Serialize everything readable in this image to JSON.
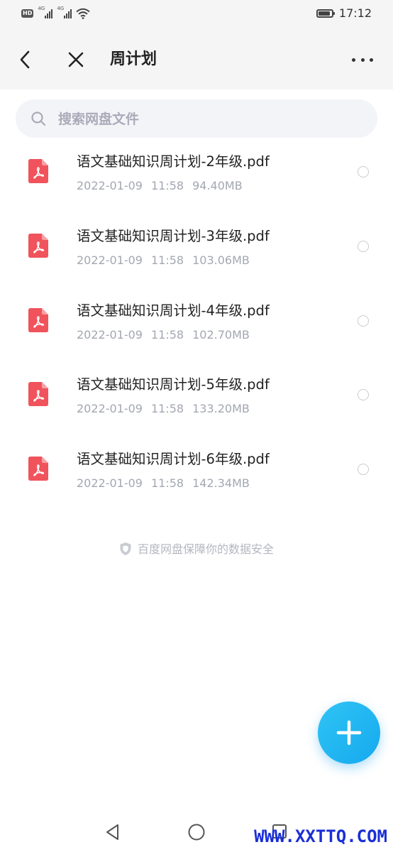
{
  "status_bar": {
    "hd_badge": "HD",
    "network_1": "4G",
    "network_2": "4G",
    "time": "17:12"
  },
  "header": {
    "title": "周计划",
    "back_icon": "chevron-left-icon",
    "close_icon": "close-icon",
    "more_icon": "more-horizontal-icon"
  },
  "search": {
    "placeholder": "搜索网盘文件",
    "value": ""
  },
  "files": [
    {
      "name": "语文基础知识周计划-2年级.pdf",
      "date": "2022-01-09",
      "time": "11:58",
      "size": "94.40MB",
      "icon": "pdf-icon",
      "selected": false
    },
    {
      "name": "语文基础知识周计划-3年级.pdf",
      "date": "2022-01-09",
      "time": "11:58",
      "size": "103.06MB",
      "icon": "pdf-icon",
      "selected": false
    },
    {
      "name": "语文基础知识周计划-4年级.pdf",
      "date": "2022-01-09",
      "time": "11:58",
      "size": "102.70MB",
      "icon": "pdf-icon",
      "selected": false
    },
    {
      "name": "语文基础知识周计划-5年级.pdf",
      "date": "2022-01-09",
      "time": "11:58",
      "size": "133.20MB",
      "icon": "pdf-icon",
      "selected": false
    },
    {
      "name": "语文基础知识周计划-6年级.pdf",
      "date": "2022-01-09",
      "time": "11:58",
      "size": "142.34MB",
      "icon": "pdf-icon",
      "selected": false
    }
  ],
  "footer_note": {
    "text": "百度网盘保障你的数据安全",
    "icon": "shield-icon"
  },
  "fab": {
    "icon": "plus-icon"
  },
  "watermark": "WWW.XXTTQ.COM",
  "colors": {
    "accent": "#1aaef0",
    "pdf_red": "#f0535c",
    "meta_gray": "#a3a7b1",
    "watermark_blue": "#1a2fd6"
  }
}
